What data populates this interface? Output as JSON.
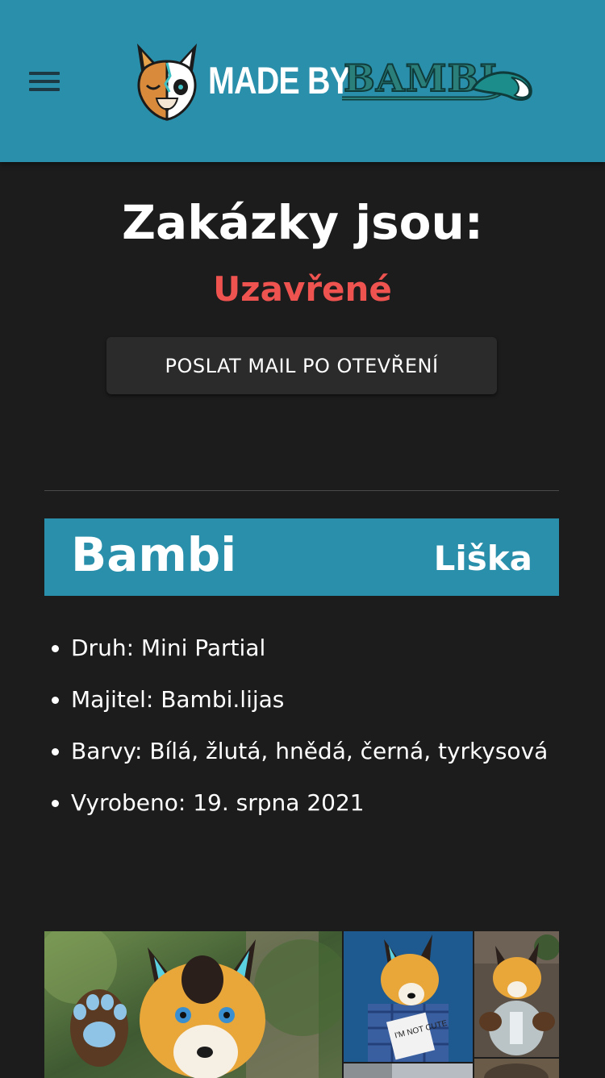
{
  "header": {
    "logo_text": "MADE BY",
    "logo_brand": "BAMBI",
    "menu_icon": "hamburger-menu-icon"
  },
  "commissions": {
    "title": "Zakázky jsou:",
    "status": "Uzavřené",
    "status_color": "#ef5350",
    "notify_button": "POSLAT MAIL PO OTEVŘENÍ"
  },
  "suit": {
    "name": "Bambi",
    "species": "Liška",
    "details": [
      "Druh: Mini Partial",
      "Majitel: Bambi.lijas",
      "Barvy: Bílá, žlutá, hnědá, černá, tyrkysová",
      "Vyrobeno: 19. srpna 2021"
    ]
  },
  "gallery": {
    "photo_sign_text": "I'M NOT CUTE"
  },
  "colors": {
    "accent": "#2a8fab",
    "background": "#1c1c1c",
    "button": "#2b2b2b"
  }
}
